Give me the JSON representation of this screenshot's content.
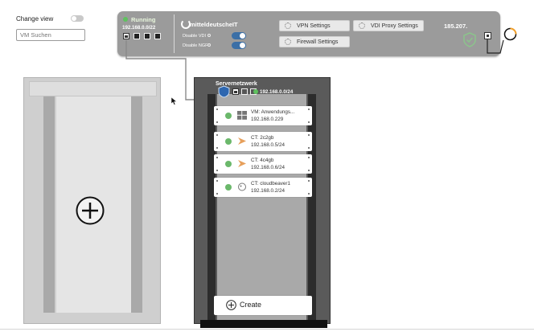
{
  "sidebar": {
    "change_view_label": "Change view",
    "search_placeholder": "VM Suchen"
  },
  "router": {
    "status": "Running",
    "subnet": "192.168.0.0/22",
    "org_name": "mitteldeutscheIT",
    "disable_vdi_label": "Disable VDI",
    "disable_ngf_label": "Disable NGF",
    "vpn_settings_label": "VPN Settings",
    "vdi_proxy_settings_label": "VDI Proxy Settings",
    "firewall_settings_label": "Firewall Settings",
    "public_ip": "185.207.",
    "status_color": "#5fc15f",
    "toggle_color": "#3b6fa6"
  },
  "rack": {
    "network_name": "Servernetzwerk",
    "network_subnet": "192.168.0.0/24",
    "create_label": "Create",
    "vms": [
      {
        "name": "VM: Anwendungs...",
        "ip": "192.168.0.229",
        "icon": "windows-icon"
      },
      {
        "name": "CT: 2c2gb",
        "ip": "192.168.0.5/24",
        "icon": "proxmox-icon"
      },
      {
        "name": "CT: 4c4gb",
        "ip": "192.168.0.6/24",
        "icon": "proxmox-icon"
      },
      {
        "name": "CT: cloudbeaver1",
        "ip": "192.168.0.2/24",
        "icon": "cloudbeaver-icon"
      }
    ]
  }
}
